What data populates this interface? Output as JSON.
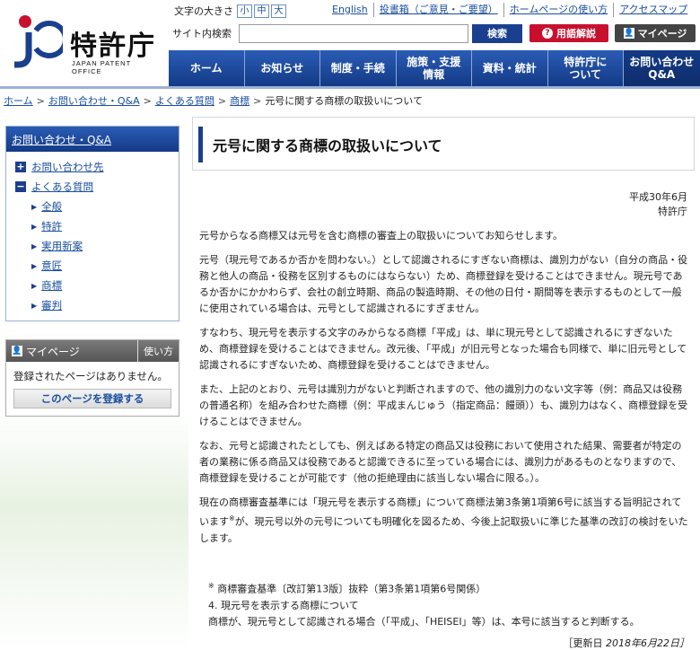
{
  "header": {
    "logo_text": "特許庁",
    "logo_sub": "JAPAN PATENT OFFICE",
    "font_size_label": "文字の大きさ",
    "font_sizes": [
      "小",
      "中",
      "大"
    ],
    "top_links": [
      "English",
      "投書箱（ご意見・ご要望）",
      "ホームページの使い方",
      "アクセスマップ"
    ],
    "search_label": "サイト内検索",
    "search_value": "",
    "search_button": "検索",
    "glossary_button": "用語解説",
    "mypage_button": "マイページ",
    "nav": [
      "ホーム",
      "お知らせ",
      "制度・手続",
      "施策・支援\n情報",
      "資料・統計",
      "特許庁に\nついて",
      "お問い合わせ\nQ&A"
    ]
  },
  "breadcrumb": {
    "items": [
      "ホーム",
      "お問い合わせ・Q&A",
      "よくある質問",
      "商標"
    ],
    "current": "元号に関する商標の取扱いについて"
  },
  "sidebar": {
    "head": "お問い合わせ・Q&A",
    "sections": [
      {
        "icon": "+",
        "label": "お問い合わせ先"
      },
      {
        "icon": "−",
        "label": "よくある質問"
      }
    ],
    "sub_items": [
      "全般",
      "特許",
      "実用新案",
      "意匠",
      "商標",
      "審判"
    ],
    "mypage": {
      "head": "マイページ",
      "howto": "使い方",
      "note": "登録されたページはありません。",
      "register": "このページを登録する"
    }
  },
  "main": {
    "title": "元号に関する商標の取扱いについて",
    "date": "平成30年6月",
    "org": "特許庁",
    "paragraphs": [
      "元号からなる商標又は元号を含む商標の審査上の取扱いについてお知らせします。",
      "元号（現元号であるか否かを問わない。）として認識されるにすぎない商標は、識別力がない（自分の商品・役務と他人の商品・役務を区別するものにはならない）ため、商標登録を受けることはできません。現元号であるか否かにかかわらず、会社の創立時期、商品の製造時期、その他の日付・期間等を表示するものとして一般に使用されている場合は、元号として認識されるにすぎません。",
      "すなわち、現元号を表示する文字のみからなる商標「平成」は、単に現元号として認識されるにすぎないため、商標登録を受けることはできません。改元後、「平成」が旧元号となった場合も同様で、単に旧元号として認識されるにすぎないため、商標登録を受けることはできません。",
      "また、上記のとおり、元号は識別力がないと判断されますので、他の識別力のない文字等（例：商品又は役務の普通名称）を組み合わせた商標（例：平成まんじゅう（指定商品：饅頭））も、識別力はなく、商標登録を受けることはできません。",
      "なお、元号と認識されたとしても、例えばある特定の商品又は役務において使用された結果、需要者が特定の者の業務に係る商品又は役務であると認識できるに至っている場合には、識別力があるものとなりますので、商標登録を受けることが可能です（他の拒絶理由に該当しない場合に限る。）。"
    ],
    "last_para_a": "現在の商標審査基準には「現元号を表示する商標」について商標法第3条第1項第6号に該当する旨明記されています",
    "last_para_mark": "※",
    "last_para_b": "が、現元号以外の元号についても明確化を図るため、今後上記取扱いに準じた基準の改訂の検討をいたします。",
    "note_mark": "※",
    "note_line1": "商標審査基準〔改訂第13版〕抜粋（第3条第1項第6号関係）",
    "note_line2": "4. 現元号を表示する商標について",
    "note_line3": "商標が、現元号として認識される場合（「平成」、「HEISEI」等）は、本号に該当すると判断する。",
    "update_label": "［更新日",
    "update_date": "2018年6月22日］"
  }
}
